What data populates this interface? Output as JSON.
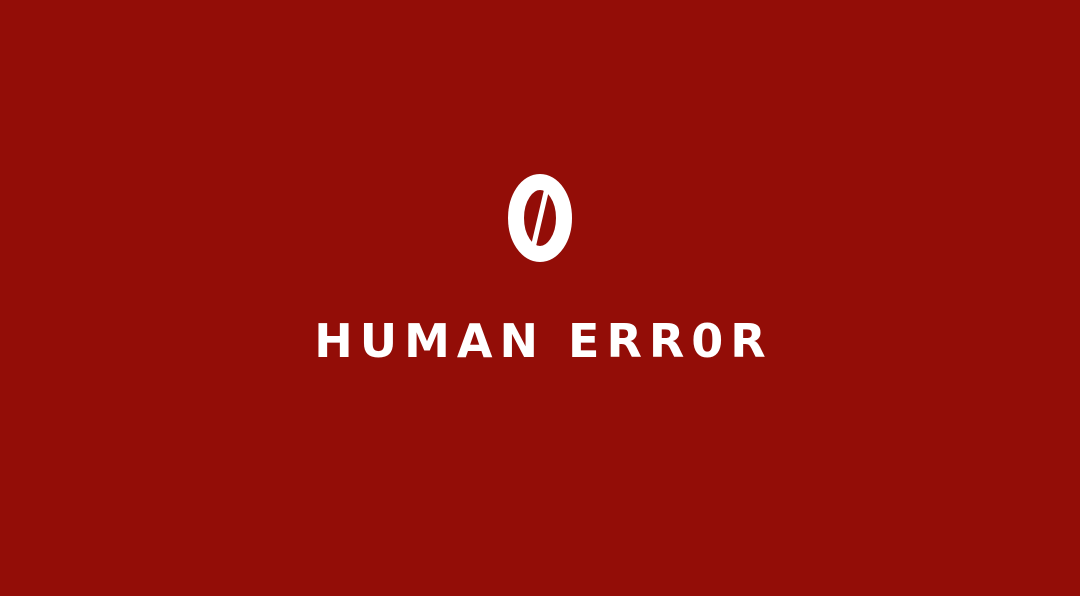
{
  "brand": {
    "mark": "zero-slash-logo-icon",
    "headline": "HUMAN ERR0R"
  },
  "colors": {
    "background": "#930d07",
    "foreground": "#ffffff"
  }
}
